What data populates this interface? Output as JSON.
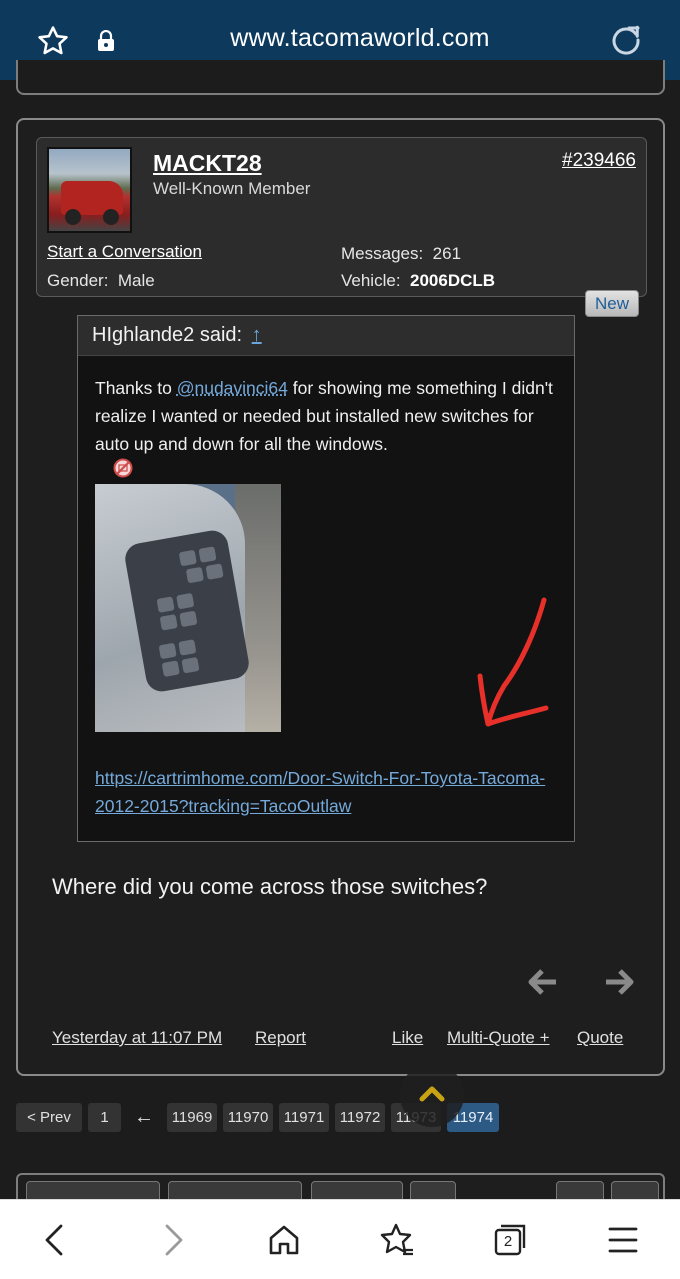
{
  "browser": {
    "url": "www.tacomaworld.com",
    "tab_count": "2"
  },
  "post": {
    "username": "MACKT28",
    "user_title": "Well-Known Member",
    "post_number": "#239466",
    "start_conversation": "Start a Conversation",
    "gender_label": "Gender:",
    "gender_value": "Male",
    "messages_label": "Messages:",
    "messages_value": "261",
    "vehicle_label": "Vehicle:",
    "vehicle_value": "2006DCLB",
    "new_badge": "New",
    "quote": {
      "author_said": "HIghlande2 said:",
      "up_arrow": "↑",
      "text_before": "Thanks to ",
      "mention": "@nudavinci64",
      "text_after": " for showing me something I didn't realize I wanted or needed but installed new switches for auto up and down for all the windows.",
      "link": "https://cartrimhome.com/Door-Switch-For-Toyota-Tacoma-2012-2015?tracking=TacoOutlaw"
    },
    "reply_text": "Where did you come across those switches?",
    "timestamp": "Yesterday at 11:07 PM",
    "report": "Report",
    "like": "Like",
    "multi_quote": "Multi-Quote +",
    "quote_btn": "Quote"
  },
  "pager": {
    "prev": "< Prev",
    "first": "1",
    "back_arrow": "←",
    "pages": [
      "11969",
      "11970",
      "11971",
      "11972",
      "11973",
      "11974"
    ],
    "current": "11974"
  },
  "icons": {
    "top": [
      "star-icon",
      "lock-icon",
      "reload-icon"
    ],
    "bottom": [
      "back-icon",
      "forward-icon",
      "home-icon",
      "bookmarks-icon",
      "tabs-icon",
      "menu-icon"
    ]
  },
  "colors": {
    "header_bg": "#0d3a5c",
    "link": "#74a9da",
    "active_page": "#2d5a85"
  }
}
